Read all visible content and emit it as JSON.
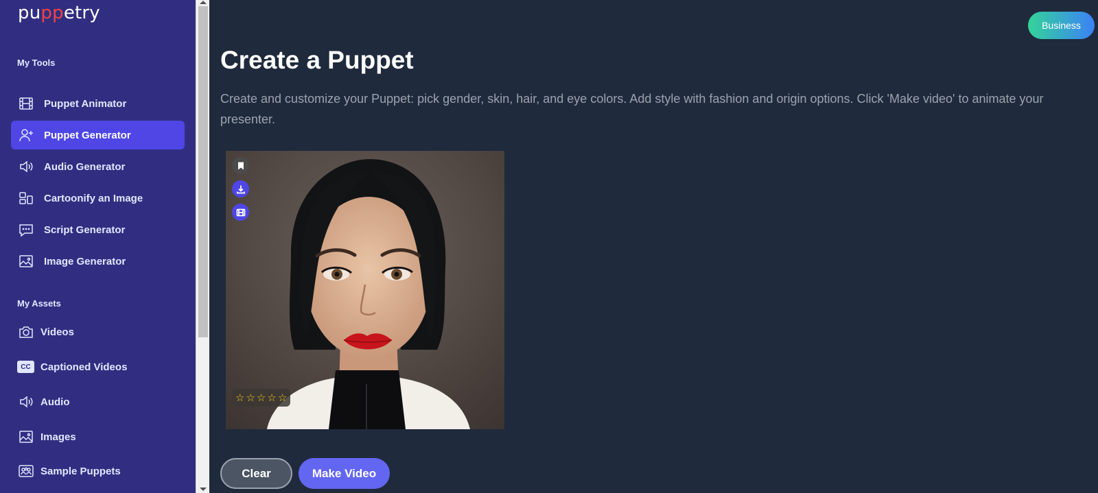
{
  "brand": {
    "logo_pre": "pu",
    "logo_mid": "pp",
    "logo_post": "etry"
  },
  "sidebar": {
    "tools_title": "My Tools",
    "tools": [
      {
        "label": "Puppet Animator",
        "icon": "film-icon",
        "active": false
      },
      {
        "label": "Puppet Generator",
        "icon": "user-plus-icon",
        "active": true
      },
      {
        "label": "Audio Generator",
        "icon": "speaker-icon",
        "active": false
      },
      {
        "label": "Cartoonify an Image",
        "icon": "layout-icon",
        "active": false
      },
      {
        "label": "Script Generator",
        "icon": "chat-icon",
        "active": false
      },
      {
        "label": "Image Generator",
        "icon": "image-icon",
        "active": false
      }
    ],
    "assets_title": "My Assets",
    "assets": [
      {
        "label": "Videos",
        "icon": "camera-icon"
      },
      {
        "label": "Captioned Videos",
        "icon": "cc-icon",
        "badge": "CC"
      },
      {
        "label": "Audio",
        "icon": "speaker-icon"
      },
      {
        "label": "Images",
        "icon": "image-icon"
      },
      {
        "label": "Sample Puppets",
        "icon": "people-icon"
      }
    ]
  },
  "header": {
    "plan_label": "Business"
  },
  "main": {
    "title": "Create a Puppet",
    "description": "Create and customize your Puppet: pick gender, skin, hair, and eye colors. Add style with fashion and origin options. Click 'Make video' to animate your presenter.",
    "puppet": {
      "rating": 0,
      "max_rating": 5,
      "star_glyph": "☆"
    },
    "clear_label": "Clear",
    "make_video_label": "Make Video"
  },
  "colors": {
    "sidebar_bg": "#312e81",
    "active_item": "#4f46e5",
    "page_bg": "#1f2a3c",
    "primary_button": "#6366f1",
    "star": "#facc15"
  }
}
